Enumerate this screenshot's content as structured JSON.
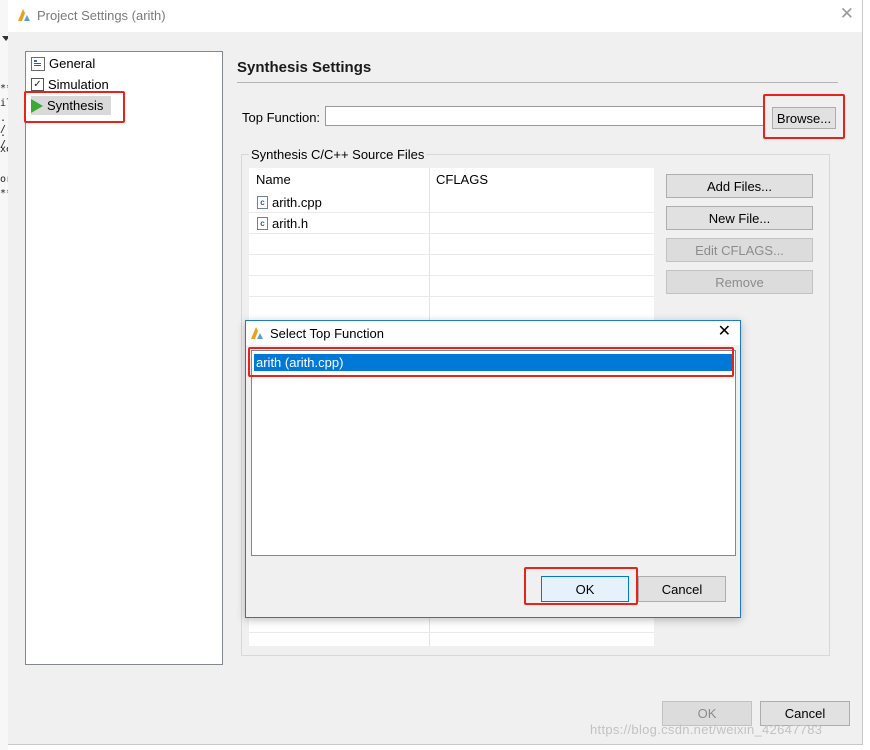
{
  "window": {
    "title": "Project Settings (arith)",
    "close_glyph": "✕"
  },
  "sidebar": {
    "items": [
      {
        "label": "General",
        "icon": "settings-page-icon"
      },
      {
        "label": "Simulation",
        "icon": "checkbox-icon",
        "checked": true
      },
      {
        "label": "Synthesis",
        "icon": "play-arrow-icon",
        "selected": true
      }
    ]
  },
  "synthesis": {
    "title": "Synthesis Settings",
    "top_function_label": "Top Function:",
    "top_function_value": "",
    "browse_label": "Browse...",
    "group_label": "Synthesis C/C++ Source Files",
    "columns": [
      "Name",
      "CFLAGS"
    ],
    "files": [
      {
        "name": "arith.cpp",
        "cflags": ""
      },
      {
        "name": "arith.h",
        "cflags": ""
      }
    ],
    "buttons": {
      "add_files": "Add Files...",
      "new_file": "New File...",
      "edit_cflags": "Edit CFLAGS...",
      "remove": "Remove"
    }
  },
  "dialog": {
    "title": "Select Top Function",
    "items": [
      "arith (arith.cpp)"
    ],
    "selected_index": 0,
    "ok_label": "OK",
    "cancel_label": "Cancel",
    "close_glyph": "✕"
  },
  "footer": {
    "ok_label": "OK",
    "cancel_label": "Cancel"
  },
  "background_text": [
    "**",
    "il",
    ". /",
    ". /",
    "xe",
    "or",
    "**"
  ],
  "watermark": "https://blog.csdn.net/weixin_42647783",
  "colors": {
    "accent": "#0078d7",
    "highlight_box": "#e8231b",
    "synthesis_icon": "#3aaa35"
  }
}
